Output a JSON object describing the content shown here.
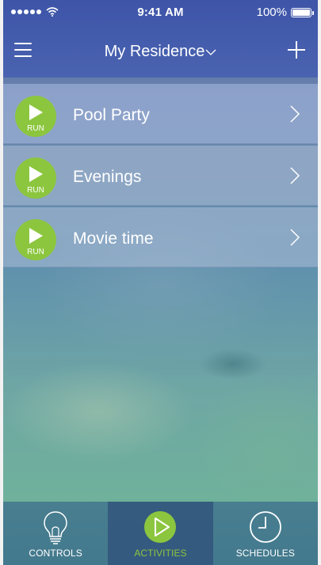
{
  "status_bar": {
    "time": "9:41 AM",
    "battery": "100%"
  },
  "nav": {
    "title": "My Residence",
    "menu_icon": "hamburger-menu-icon",
    "title_icon": "chevron-down-icon",
    "add_icon": "plus-icon"
  },
  "activities": [
    {
      "label": "Pool Party",
      "run_label": "RUN"
    },
    {
      "label": "Evenings",
      "run_label": "RUN"
    },
    {
      "label": "Movie time",
      "run_label": "RUN"
    }
  ],
  "tabbar": {
    "tabs": [
      {
        "label": "CONTROLS",
        "icon": "lightbulb-icon",
        "active": false
      },
      {
        "label": "ACTIVITIES",
        "icon": "play-circle-icon",
        "active": true
      },
      {
        "label": "SCHEDULES",
        "icon": "clock-icon",
        "active": false
      }
    ]
  },
  "colors": {
    "accent": "#8cc63f",
    "header": "#4a63b0"
  }
}
